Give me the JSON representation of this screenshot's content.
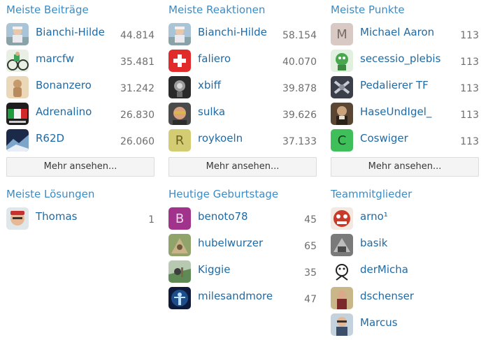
{
  "sections": {
    "posts": {
      "title": "Meiste Beiträge",
      "more": "Mehr ansehen...",
      "members": [
        {
          "name": "Bianchi-Hilde",
          "count": "44.814"
        },
        {
          "name": "marcfw",
          "count": "35.481"
        },
        {
          "name": "Bonanzero",
          "count": "31.242"
        },
        {
          "name": "Adrenalino",
          "count": "26.830"
        },
        {
          "name": "R62D",
          "count": "26.060"
        }
      ]
    },
    "reactions": {
      "title": "Meiste Reaktionen",
      "more": "Mehr ansehen...",
      "members": [
        {
          "name": "Bianchi-Hilde",
          "count": "58.154"
        },
        {
          "name": "faliero",
          "count": "40.070"
        },
        {
          "name": "xbiff",
          "count": "39.878"
        },
        {
          "name": "sulka",
          "count": "39.626"
        },
        {
          "name": "roykoeln",
          "count": "37.133",
          "letter": "R"
        }
      ]
    },
    "points": {
      "title": "Meiste Punkte",
      "more": "Mehr ansehen...",
      "members": [
        {
          "name": "Michael Aaron",
          "count": "113",
          "letter": "M"
        },
        {
          "name": "secessio_plebis",
          "count": "113"
        },
        {
          "name": "Pedalierer TF",
          "count": "113"
        },
        {
          "name": "HaseUndIgel_",
          "count": "113"
        },
        {
          "name": "Coswiger",
          "count": "113",
          "letter": "C"
        }
      ]
    },
    "solutions": {
      "title": "Meiste Lösungen",
      "members": [
        {
          "name": "Thomas",
          "count": "1"
        }
      ]
    },
    "birthdays": {
      "title": "Heutige Geburtstage",
      "members": [
        {
          "name": "benoto78",
          "count": "45",
          "letter": "B"
        },
        {
          "name": "hubelwurzer",
          "count": "65"
        },
        {
          "name": "Kiggie",
          "count": "35"
        },
        {
          "name": "milesandmore",
          "count": "47"
        }
      ]
    },
    "team": {
      "title": "Teammitglieder",
      "members": [
        {
          "name": "arno¹"
        },
        {
          "name": "basik"
        },
        {
          "name": "derMicha"
        },
        {
          "name": "dschenser"
        },
        {
          "name": "Marcus"
        }
      ]
    }
  },
  "colors": {
    "title": "#3a8cc7",
    "link": "#1f6aa5",
    "count": "#6e6e6e",
    "letter_m_bg": "#d9c9c4",
    "letter_r_bg": "#d4cc72",
    "letter_c_bg": "#3fbf5a",
    "letter_b_bg": "#a1338c"
  }
}
